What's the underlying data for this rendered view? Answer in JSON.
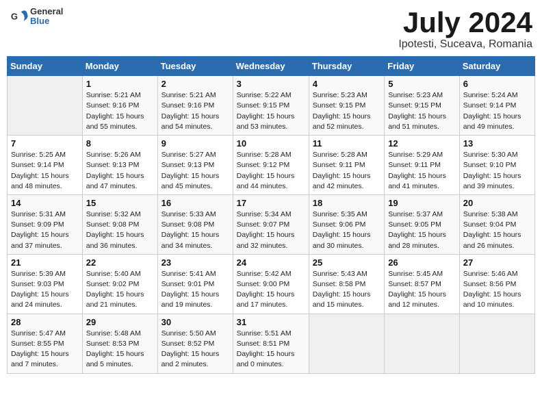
{
  "header": {
    "logo_general": "General",
    "logo_blue": "Blue",
    "title": "July 2024",
    "location": "Ipotesti, Suceava, Romania"
  },
  "weekdays": [
    "Sunday",
    "Monday",
    "Tuesday",
    "Wednesday",
    "Thursday",
    "Friday",
    "Saturday"
  ],
  "weeks": [
    [
      {
        "day": "",
        "info": ""
      },
      {
        "day": "1",
        "info": "Sunrise: 5:21 AM\nSunset: 9:16 PM\nDaylight: 15 hours\nand 55 minutes."
      },
      {
        "day": "2",
        "info": "Sunrise: 5:21 AM\nSunset: 9:16 PM\nDaylight: 15 hours\nand 54 minutes."
      },
      {
        "day": "3",
        "info": "Sunrise: 5:22 AM\nSunset: 9:15 PM\nDaylight: 15 hours\nand 53 minutes."
      },
      {
        "day": "4",
        "info": "Sunrise: 5:23 AM\nSunset: 9:15 PM\nDaylight: 15 hours\nand 52 minutes."
      },
      {
        "day": "5",
        "info": "Sunrise: 5:23 AM\nSunset: 9:15 PM\nDaylight: 15 hours\nand 51 minutes."
      },
      {
        "day": "6",
        "info": "Sunrise: 5:24 AM\nSunset: 9:14 PM\nDaylight: 15 hours\nand 49 minutes."
      }
    ],
    [
      {
        "day": "7",
        "info": "Sunrise: 5:25 AM\nSunset: 9:14 PM\nDaylight: 15 hours\nand 48 minutes."
      },
      {
        "day": "8",
        "info": "Sunrise: 5:26 AM\nSunset: 9:13 PM\nDaylight: 15 hours\nand 47 minutes."
      },
      {
        "day": "9",
        "info": "Sunrise: 5:27 AM\nSunset: 9:13 PM\nDaylight: 15 hours\nand 45 minutes."
      },
      {
        "day": "10",
        "info": "Sunrise: 5:28 AM\nSunset: 9:12 PM\nDaylight: 15 hours\nand 44 minutes."
      },
      {
        "day": "11",
        "info": "Sunrise: 5:28 AM\nSunset: 9:11 PM\nDaylight: 15 hours\nand 42 minutes."
      },
      {
        "day": "12",
        "info": "Sunrise: 5:29 AM\nSunset: 9:11 PM\nDaylight: 15 hours\nand 41 minutes."
      },
      {
        "day": "13",
        "info": "Sunrise: 5:30 AM\nSunset: 9:10 PM\nDaylight: 15 hours\nand 39 minutes."
      }
    ],
    [
      {
        "day": "14",
        "info": "Sunrise: 5:31 AM\nSunset: 9:09 PM\nDaylight: 15 hours\nand 37 minutes."
      },
      {
        "day": "15",
        "info": "Sunrise: 5:32 AM\nSunset: 9:08 PM\nDaylight: 15 hours\nand 36 minutes."
      },
      {
        "day": "16",
        "info": "Sunrise: 5:33 AM\nSunset: 9:08 PM\nDaylight: 15 hours\nand 34 minutes."
      },
      {
        "day": "17",
        "info": "Sunrise: 5:34 AM\nSunset: 9:07 PM\nDaylight: 15 hours\nand 32 minutes."
      },
      {
        "day": "18",
        "info": "Sunrise: 5:35 AM\nSunset: 9:06 PM\nDaylight: 15 hours\nand 30 minutes."
      },
      {
        "day": "19",
        "info": "Sunrise: 5:37 AM\nSunset: 9:05 PM\nDaylight: 15 hours\nand 28 minutes."
      },
      {
        "day": "20",
        "info": "Sunrise: 5:38 AM\nSunset: 9:04 PM\nDaylight: 15 hours\nand 26 minutes."
      }
    ],
    [
      {
        "day": "21",
        "info": "Sunrise: 5:39 AM\nSunset: 9:03 PM\nDaylight: 15 hours\nand 24 minutes."
      },
      {
        "day": "22",
        "info": "Sunrise: 5:40 AM\nSunset: 9:02 PM\nDaylight: 15 hours\nand 21 minutes."
      },
      {
        "day": "23",
        "info": "Sunrise: 5:41 AM\nSunset: 9:01 PM\nDaylight: 15 hours\nand 19 minutes."
      },
      {
        "day": "24",
        "info": "Sunrise: 5:42 AM\nSunset: 9:00 PM\nDaylight: 15 hours\nand 17 minutes."
      },
      {
        "day": "25",
        "info": "Sunrise: 5:43 AM\nSunset: 8:58 PM\nDaylight: 15 hours\nand 15 minutes."
      },
      {
        "day": "26",
        "info": "Sunrise: 5:45 AM\nSunset: 8:57 PM\nDaylight: 15 hours\nand 12 minutes."
      },
      {
        "day": "27",
        "info": "Sunrise: 5:46 AM\nSunset: 8:56 PM\nDaylight: 15 hours\nand 10 minutes."
      }
    ],
    [
      {
        "day": "28",
        "info": "Sunrise: 5:47 AM\nSunset: 8:55 PM\nDaylight: 15 hours\nand 7 minutes."
      },
      {
        "day": "29",
        "info": "Sunrise: 5:48 AM\nSunset: 8:53 PM\nDaylight: 15 hours\nand 5 minutes."
      },
      {
        "day": "30",
        "info": "Sunrise: 5:50 AM\nSunset: 8:52 PM\nDaylight: 15 hours\nand 2 minutes."
      },
      {
        "day": "31",
        "info": "Sunrise: 5:51 AM\nSunset: 8:51 PM\nDaylight: 15 hours\nand 0 minutes."
      },
      {
        "day": "",
        "info": ""
      },
      {
        "day": "",
        "info": ""
      },
      {
        "day": "",
        "info": ""
      }
    ]
  ]
}
